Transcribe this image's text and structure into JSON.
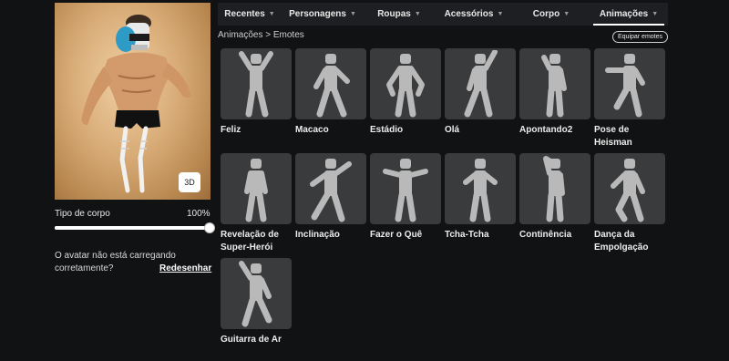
{
  "avatar": {
    "view_button": "3D",
    "body_type_label": "Tipo de corpo",
    "body_type_value": "100%",
    "body_type_fraction": 1.0,
    "message_line1": "O avatar não está carregando",
    "message_line2": "corretamente?",
    "redraw_link": "Redesenhar"
  },
  "tabs": [
    {
      "label": "Recentes",
      "active": false
    },
    {
      "label": "Personagens",
      "active": false
    },
    {
      "label": "Roupas",
      "active": false
    },
    {
      "label": "Acessórios",
      "active": false
    },
    {
      "label": "Corpo",
      "active": false
    },
    {
      "label": "Animações",
      "active": true
    }
  ],
  "breadcrumb": {
    "parent": "Animações",
    "separator": ">",
    "current": "Emotes"
  },
  "equip_button": "Equipar emotes",
  "emotes": [
    {
      "name": "Feliz",
      "pose": "cheer"
    },
    {
      "name": "Macaco",
      "pose": "monkey"
    },
    {
      "name": "Estádio",
      "pose": "stadium"
    },
    {
      "name": "Olá",
      "pose": "wave"
    },
    {
      "name": "Apontando2",
      "pose": "point"
    },
    {
      "name": "Pose de Heisman",
      "pose": "heisman"
    },
    {
      "name": "Revelação de Super-Herói",
      "pose": "hero"
    },
    {
      "name": "Inclinação",
      "pose": "lean"
    },
    {
      "name": "Fazer o Quê",
      "pose": "shrug"
    },
    {
      "name": "Tcha-Tcha",
      "pose": "chacha"
    },
    {
      "name": "Continência",
      "pose": "salute"
    },
    {
      "name": "Dança da Empolgação",
      "pose": "hype"
    },
    {
      "name": "Guitarra de Ar",
      "pose": "guitar"
    }
  ],
  "colors": {
    "background": "#111213",
    "tabbar": "#1e1f22",
    "card": "#393b3d",
    "figure": "#b9b9b9"
  }
}
